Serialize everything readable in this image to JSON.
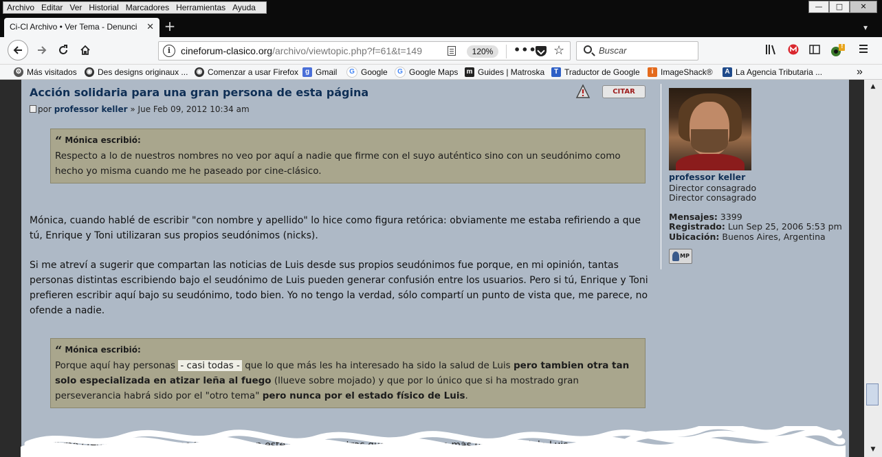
{
  "menu": [
    "Archivo",
    "Editar",
    "Ver",
    "Historial",
    "Marcadores",
    "Herramientas",
    "Ayuda"
  ],
  "window": {
    "minimize": "—",
    "maximize": "□",
    "close": "✕"
  },
  "tab": {
    "title": "Ci-Cl Archivo • Ver Tema - Denunci",
    "close": "✕",
    "new": "+"
  },
  "nav": {
    "url_host": "cineforum-clasico.org",
    "url_path": "/archivo/viewtopic.php?f=61&t=149",
    "zoom": "120%",
    "search_placeholder": "Buscar",
    "ext_badge": "!"
  },
  "bookmarks": [
    "Más visitados",
    "Des designs originaux ...",
    "Comenzar a usar Firefox",
    "Gmail",
    "Google",
    "Google Maps",
    "Guides | Matroska",
    "Traductor de Google",
    "ImageShack®",
    "La Agencia Tributaria ..."
  ],
  "post": {
    "title": "Acción solidaria para una gran persona de esta página",
    "by": "por",
    "author": "professor keller",
    "date": "» Jue Feb 09, 2012 10:34 am",
    "quote_button": "CITAR",
    "quote1": {
      "cite": "Mónica escribió:",
      "text": "Respecto a lo de nuestros nombres no veo por aquí a nadie que firme con el suyo auténtico sino con un seudónimo como hecho yo misma cuando me he paseado por cine-clásico."
    },
    "para1": "Mónica, cuando hablé de escribir \"con nombre y apellido\" lo hice como figura retórica: obviamente me estaba refiriendo a que tú, Enrique y Toni utilizaran sus propios seudónimos (nicks).",
    "para2": "Si me atreví a sugerir que compartan las noticias de Luis desde sus propios seudónimos fue porque, en mi opinión, tantas personas distintas escribiendo bajo el seudónimo de Luis pueden generar confusión entre los usuarios. Pero si tú, Enrique y Toni prefieren escribir aquí bajo su seudónimo, todo bien. Yo no tengo la verdad, sólo compartí un punto de vista que, me parece, no ofende a nadie.",
    "quote2": {
      "cite": "Mónica escribió:",
      "t1": "Porque aquí hay personas",
      "highlight": "- casi todas -",
      "t2": " que lo que más les ha interesado ha sido la salud de Luis ",
      "b1": "pero tambien otra tan solo especializada en atizar leña al fuego",
      "t3": " (llueve sobre mojado) y que por lo único que si ha mostrado gran perseverancia habrá sido por el \"otro tema\" ",
      "b2": "pero nunca por el estado físico de Luis",
      "t4": "."
    },
    "para3": "Por último creo que, siendo como tú has sido en este tema, hay otras que se interesan más por la salud de Luis"
  },
  "profile": {
    "name": "professor keller",
    "rank1": "Director consagrado",
    "rank2": "Director consagrado",
    "posts_label": "Mensajes:",
    "posts_value": "3399",
    "registered_label": "Registrado:",
    "registered_value": "Lun Sep 25, 2006 5:53 pm",
    "location_label": "Ubicación:",
    "location_value": "Buenos Aires, Argentina",
    "pm_label": "MP"
  }
}
